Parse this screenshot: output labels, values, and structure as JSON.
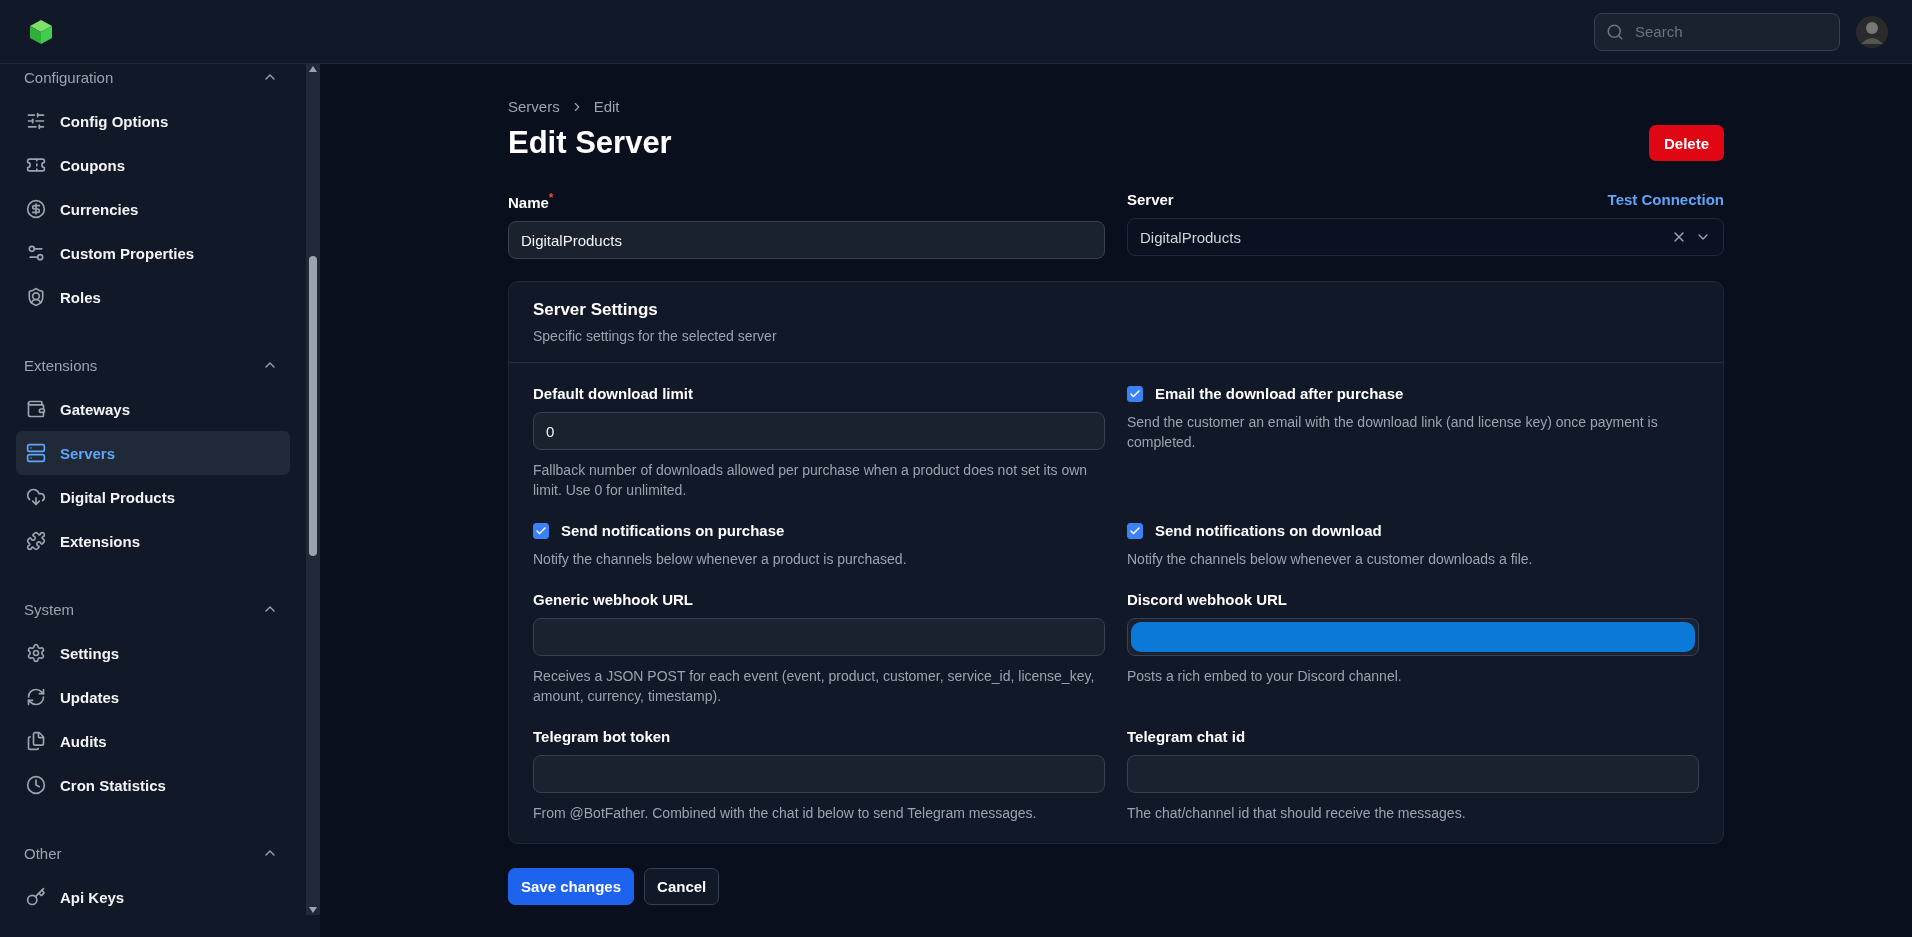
{
  "header": {
    "search": {
      "placeholder": "Search"
    }
  },
  "sidebar": {
    "sections": [
      {
        "title": "Configuration",
        "expanded": true,
        "items": [
          {
            "label": "Config Options",
            "selected": false
          },
          {
            "label": "Coupons",
            "selected": false
          },
          {
            "label": "Currencies",
            "selected": false
          },
          {
            "label": "Custom Properties",
            "selected": false
          },
          {
            "label": "Roles",
            "selected": false
          }
        ]
      },
      {
        "title": "Extensions",
        "expanded": true,
        "items": [
          {
            "label": "Gateways",
            "selected": false
          },
          {
            "label": "Servers",
            "selected": true
          },
          {
            "label": "Digital Products",
            "selected": false
          },
          {
            "label": "Extensions",
            "selected": false
          }
        ]
      },
      {
        "title": "System",
        "expanded": true,
        "items": [
          {
            "label": "Settings",
            "selected": false
          },
          {
            "label": "Updates",
            "selected": false
          },
          {
            "label": "Audits",
            "selected": false
          },
          {
            "label": "Cron Statistics",
            "selected": false
          }
        ]
      },
      {
        "title": "Other",
        "expanded": true,
        "items": [
          {
            "label": "Api Keys",
            "selected": false
          }
        ]
      }
    ]
  },
  "breadcrumb": [
    "Servers",
    "Edit"
  ],
  "page_title": "Edit Server",
  "delete_button": "Delete",
  "name_field": {
    "label": "Name",
    "required_mark": "*",
    "value": "DigitalProducts"
  },
  "server_field": {
    "label": "Server",
    "action": "Test Connection",
    "value": "DigitalProducts"
  },
  "settings_card": {
    "title": "Server Settings",
    "subtitle": "Specific settings for the selected server",
    "fields": [
      {
        "kind": "input",
        "label": "Default download limit",
        "value": "0",
        "help": "Fallback number of downloads allowed per purchase when a product does not set its own limit. Use 0 for unlimited."
      },
      {
        "kind": "checkbox",
        "label": "Email the download after purchase",
        "checked": true,
        "help": "Send the customer an email with the download link (and license key) once payment is completed."
      },
      {
        "kind": "checkbox",
        "label": "Send notifications on purchase",
        "checked": true,
        "help": "Notify the channels below whenever a product is purchased."
      },
      {
        "kind": "checkbox",
        "label": "Send notifications on download",
        "checked": true,
        "help": "Notify the channels below whenever a customer downloads a file."
      },
      {
        "kind": "input",
        "label": "Generic webhook URL",
        "highlighted": false,
        "help": "Receives a JSON POST for each event (event, product, customer, service_id, license_key, amount, currency, timestamp)."
      },
      {
        "kind": "input",
        "label": "Discord webhook URL",
        "highlighted": true,
        "help": "Posts a rich embed to your Discord channel."
      },
      {
        "kind": "input",
        "label": "Telegram bot token",
        "highlighted": false,
        "help": "From @BotFather. Combined with the chat id below to send Telegram messages."
      },
      {
        "kind": "input",
        "label": "Telegram chat id",
        "highlighted": false,
        "help": "The chat/channel id that should receive the messages."
      }
    ]
  },
  "buttons": [
    {
      "label": "Save changes",
      "kind": "primary"
    },
    {
      "label": "Cancel",
      "kind": "secondary"
    }
  ]
}
